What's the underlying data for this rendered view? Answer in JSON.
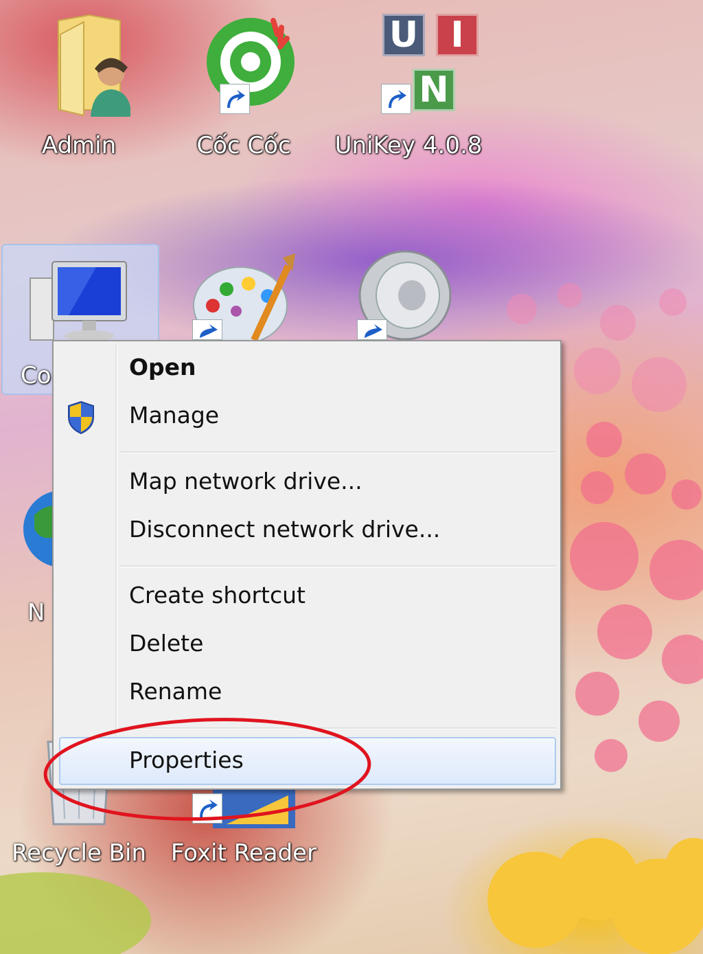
{
  "desktop": {
    "icons": [
      {
        "label": "Admin",
        "icon": "user-folder-icon"
      },
      {
        "label": "Cốc Cốc",
        "icon": "coccoc-browser-icon"
      },
      {
        "label": "UniKey 4.0.8",
        "icon": "unikey-icon"
      },
      {
        "label": "Co",
        "icon": "computer-icon"
      },
      {
        "label": "",
        "icon": "paint-palette-icon"
      },
      {
        "label": "",
        "icon": "speaker-icon"
      },
      {
        "label": "N",
        "icon": "network-globe-icon"
      },
      {
        "label": "Recycle Bin",
        "icon": "recycle-bin-icon"
      },
      {
        "label": "Foxit Reader",
        "icon": "foxit-reader-icon"
      }
    ],
    "unikey_letters": [
      "U",
      "I",
      "N"
    ]
  },
  "context_menu": {
    "items": [
      {
        "label": "Open",
        "bold": true
      },
      {
        "label": "Manage",
        "icon": "uac-shield-icon"
      },
      {
        "label": "Map network drive..."
      },
      {
        "label": "Disconnect network drive..."
      },
      {
        "label": "Create shortcut"
      },
      {
        "label": "Delete"
      },
      {
        "label": "Rename"
      },
      {
        "label": "Properties",
        "highlighted": true
      }
    ]
  },
  "colors": {
    "menu_background": "#f0f0f0",
    "highlight_border": "#aecbf0",
    "annotation_red": "#e0141e"
  }
}
